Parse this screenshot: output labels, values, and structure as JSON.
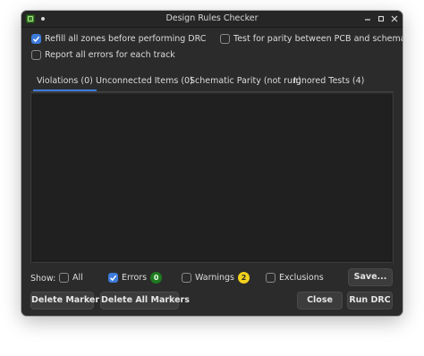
{
  "window": {
    "title": "Design Rules Checker"
  },
  "options": {
    "refill_zones": {
      "label": "Refill all zones before performing DRC",
      "checked": true
    },
    "parity_test": {
      "label": "Test for parity between PCB and schematic",
      "checked": false
    },
    "report_all_errors": {
      "label": "Report all errors for each track",
      "checked": false
    }
  },
  "tabs": [
    {
      "label": "Violations (0)",
      "active": true
    },
    {
      "label": "Unconnected Items (0)",
      "active": false
    },
    {
      "label": "Schematic Parity (not run)",
      "active": false
    },
    {
      "label": "Ignored Tests (4)",
      "active": false
    }
  ],
  "filters": {
    "show_label": "Show:",
    "all": {
      "label": "All",
      "checked": false
    },
    "errors": {
      "label": "Errors",
      "checked": true,
      "count": "0",
      "badge_color": "#1f7a1f"
    },
    "warnings": {
      "label": "Warnings",
      "checked": false,
      "count": "2",
      "badge_color": "#f2d21b"
    },
    "exclusions": {
      "label": "Exclusions",
      "checked": false
    }
  },
  "buttons": {
    "save": "Save...",
    "delete_marker": "Delete Marker",
    "delete_all_markers": "Delete All Markers",
    "close": "Close",
    "run_drc": "Run DRC"
  },
  "colors": {
    "accent": "#3d7bdc",
    "background": "#2b2b2b"
  }
}
